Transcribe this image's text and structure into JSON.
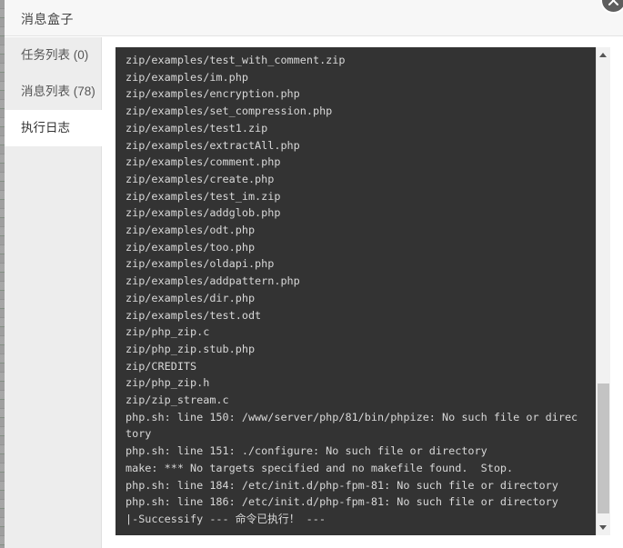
{
  "dialog": {
    "title": "消息盒子",
    "close_label": "关闭"
  },
  "sidebar": {
    "items": [
      {
        "label": "任务列表 (0)",
        "name": "task-list",
        "active": false
      },
      {
        "label": "消息列表 (78)",
        "name": "message-list",
        "active": false
      },
      {
        "label": "执行日志",
        "name": "execution-log",
        "active": true
      }
    ]
  },
  "console": {
    "lines": [
      "zip/examples/test_with_comment.zip",
      "zip/examples/im.php",
      "zip/examples/encryption.php",
      "zip/examples/set_compression.php",
      "zip/examples/test1.zip",
      "zip/examples/extractAll.php",
      "zip/examples/comment.php",
      "zip/examples/create.php",
      "zip/examples/test_im.zip",
      "zip/examples/addglob.php",
      "zip/examples/odt.php",
      "zip/examples/too.php",
      "zip/examples/oldapi.php",
      "zip/examples/addpattern.php",
      "zip/examples/dir.php",
      "zip/examples/test.odt",
      "zip/php_zip.c",
      "zip/php_zip.stub.php",
      "zip/CREDITS",
      "zip/php_zip.h",
      "zip/zip_stream.c",
      "php.sh: line 150: /www/server/php/81/bin/phpize: No such file or direc",
      "tory",
      "php.sh: line 151: ./configure: No such file or directory",
      "make: *** No targets specified and no makefile found.  Stop.",
      "php.sh: line 184: /etc/init.d/php-fpm-81: No such file or directory",
      "php.sh: line 186: /etc/init.d/php-fpm-81: No such file or directory",
      "|-Successify --- 命令已执行！ ---"
    ],
    "scrollbar": {
      "up_icon": "triangle-up-icon",
      "down_icon": "triangle-down-icon",
      "thumb_position_percent": 70
    }
  },
  "colors": {
    "console_background": "#333333",
    "console_text": "#d8d8d8",
    "sidebar_background": "#ededed",
    "header_background": "#f7f7f7",
    "accent_red": "#c94f4f",
    "scrollbar_thumb": "#c3c3c3"
  }
}
